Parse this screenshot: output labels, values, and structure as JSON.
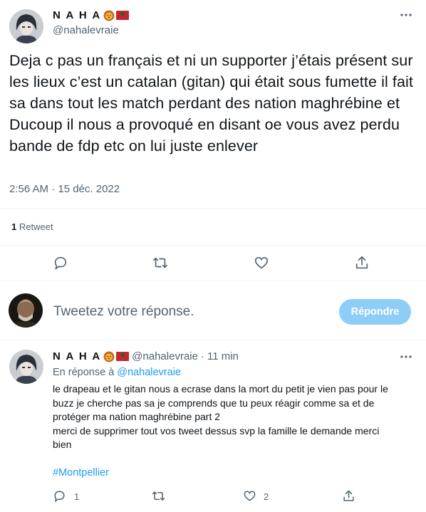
{
  "tweet": {
    "author": {
      "display_name": "N A H A",
      "handle": "@nahalevraie"
    },
    "text": "Deja c pas un français et ni un supporter j’étais présent sur les lieux c’est un catalan (gitan) qui était sous fumette il fait sa dans tout les match perdant des nation maghrébine et Ducoup il nous a provoqué en disant oe vous avez perdu bande de fdp etc on lui juste enlever",
    "timestamp": "2:56 AM · 15 déc. 2022",
    "retweets": {
      "count": "1",
      "label": "Retweet"
    }
  },
  "compose": {
    "placeholder": "Tweetez votre réponse.",
    "button_label": "Répondre"
  },
  "reply": {
    "author": {
      "display_name": "N A H A",
      "handle": "@nahalevraie",
      "time": "11 min"
    },
    "replying_prefix": "En réponse à",
    "replying_to": "@nahalevraie",
    "text_lines": [
      "le drapeau et le gitan nous a ecrase dans la mort du petit je vien pas pour le",
      "buzz je cherche pas sa je comprends que tu peux réagir comme sa et de",
      "protéger ma nation maghrébine part 2",
      "merci de supprimer tout vos tweet dessus svp la famille le demande merci",
      "bien"
    ],
    "hashtag": "#Montpellier",
    "reply_count": "1",
    "like_count": "2"
  },
  "icons": {
    "more": "more-horizontal-icon",
    "reply": "reply-bubble-icon",
    "retweet": "retweet-icon",
    "like": "heart-icon",
    "share": "share-icon"
  },
  "colors": {
    "accent": "#1d9bf0",
    "button_disabled": "#8ecdf8",
    "muted_text": "#536471",
    "divider": "#eff3f4"
  }
}
